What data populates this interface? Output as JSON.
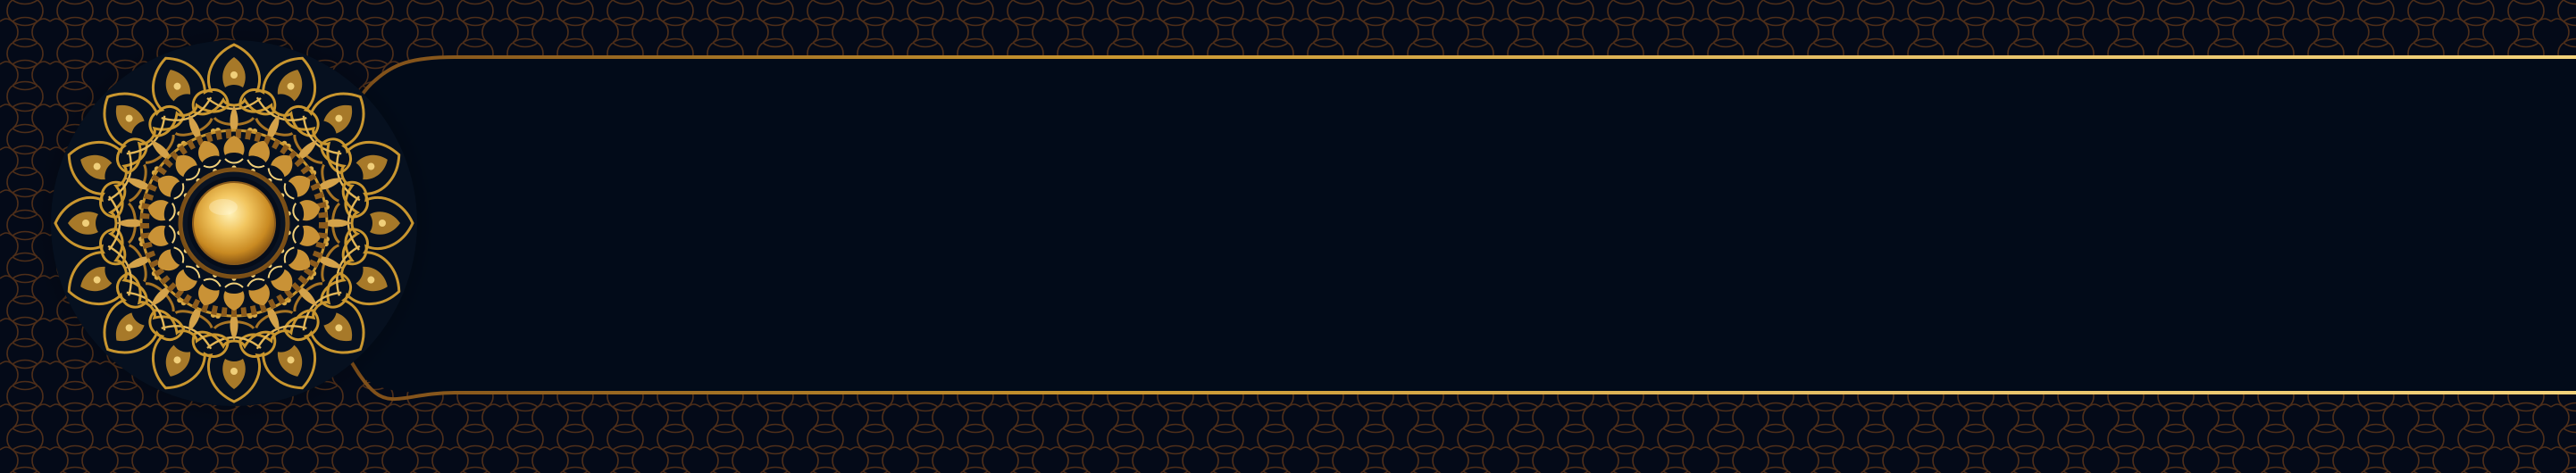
{
  "banner": {
    "colors": {
      "background": "#040a18",
      "panel": "#020b19",
      "pattern_stroke": "#5a3418",
      "gold_light": "#f3d27a",
      "gold_mid": "#c9962f",
      "gold_dark": "#8a5a1c"
    },
    "ornament": {
      "name": "gold-mandala-ornament",
      "center_gem": "gold-orb"
    },
    "pattern": {
      "name": "arabesque-lattice"
    },
    "text": []
  }
}
